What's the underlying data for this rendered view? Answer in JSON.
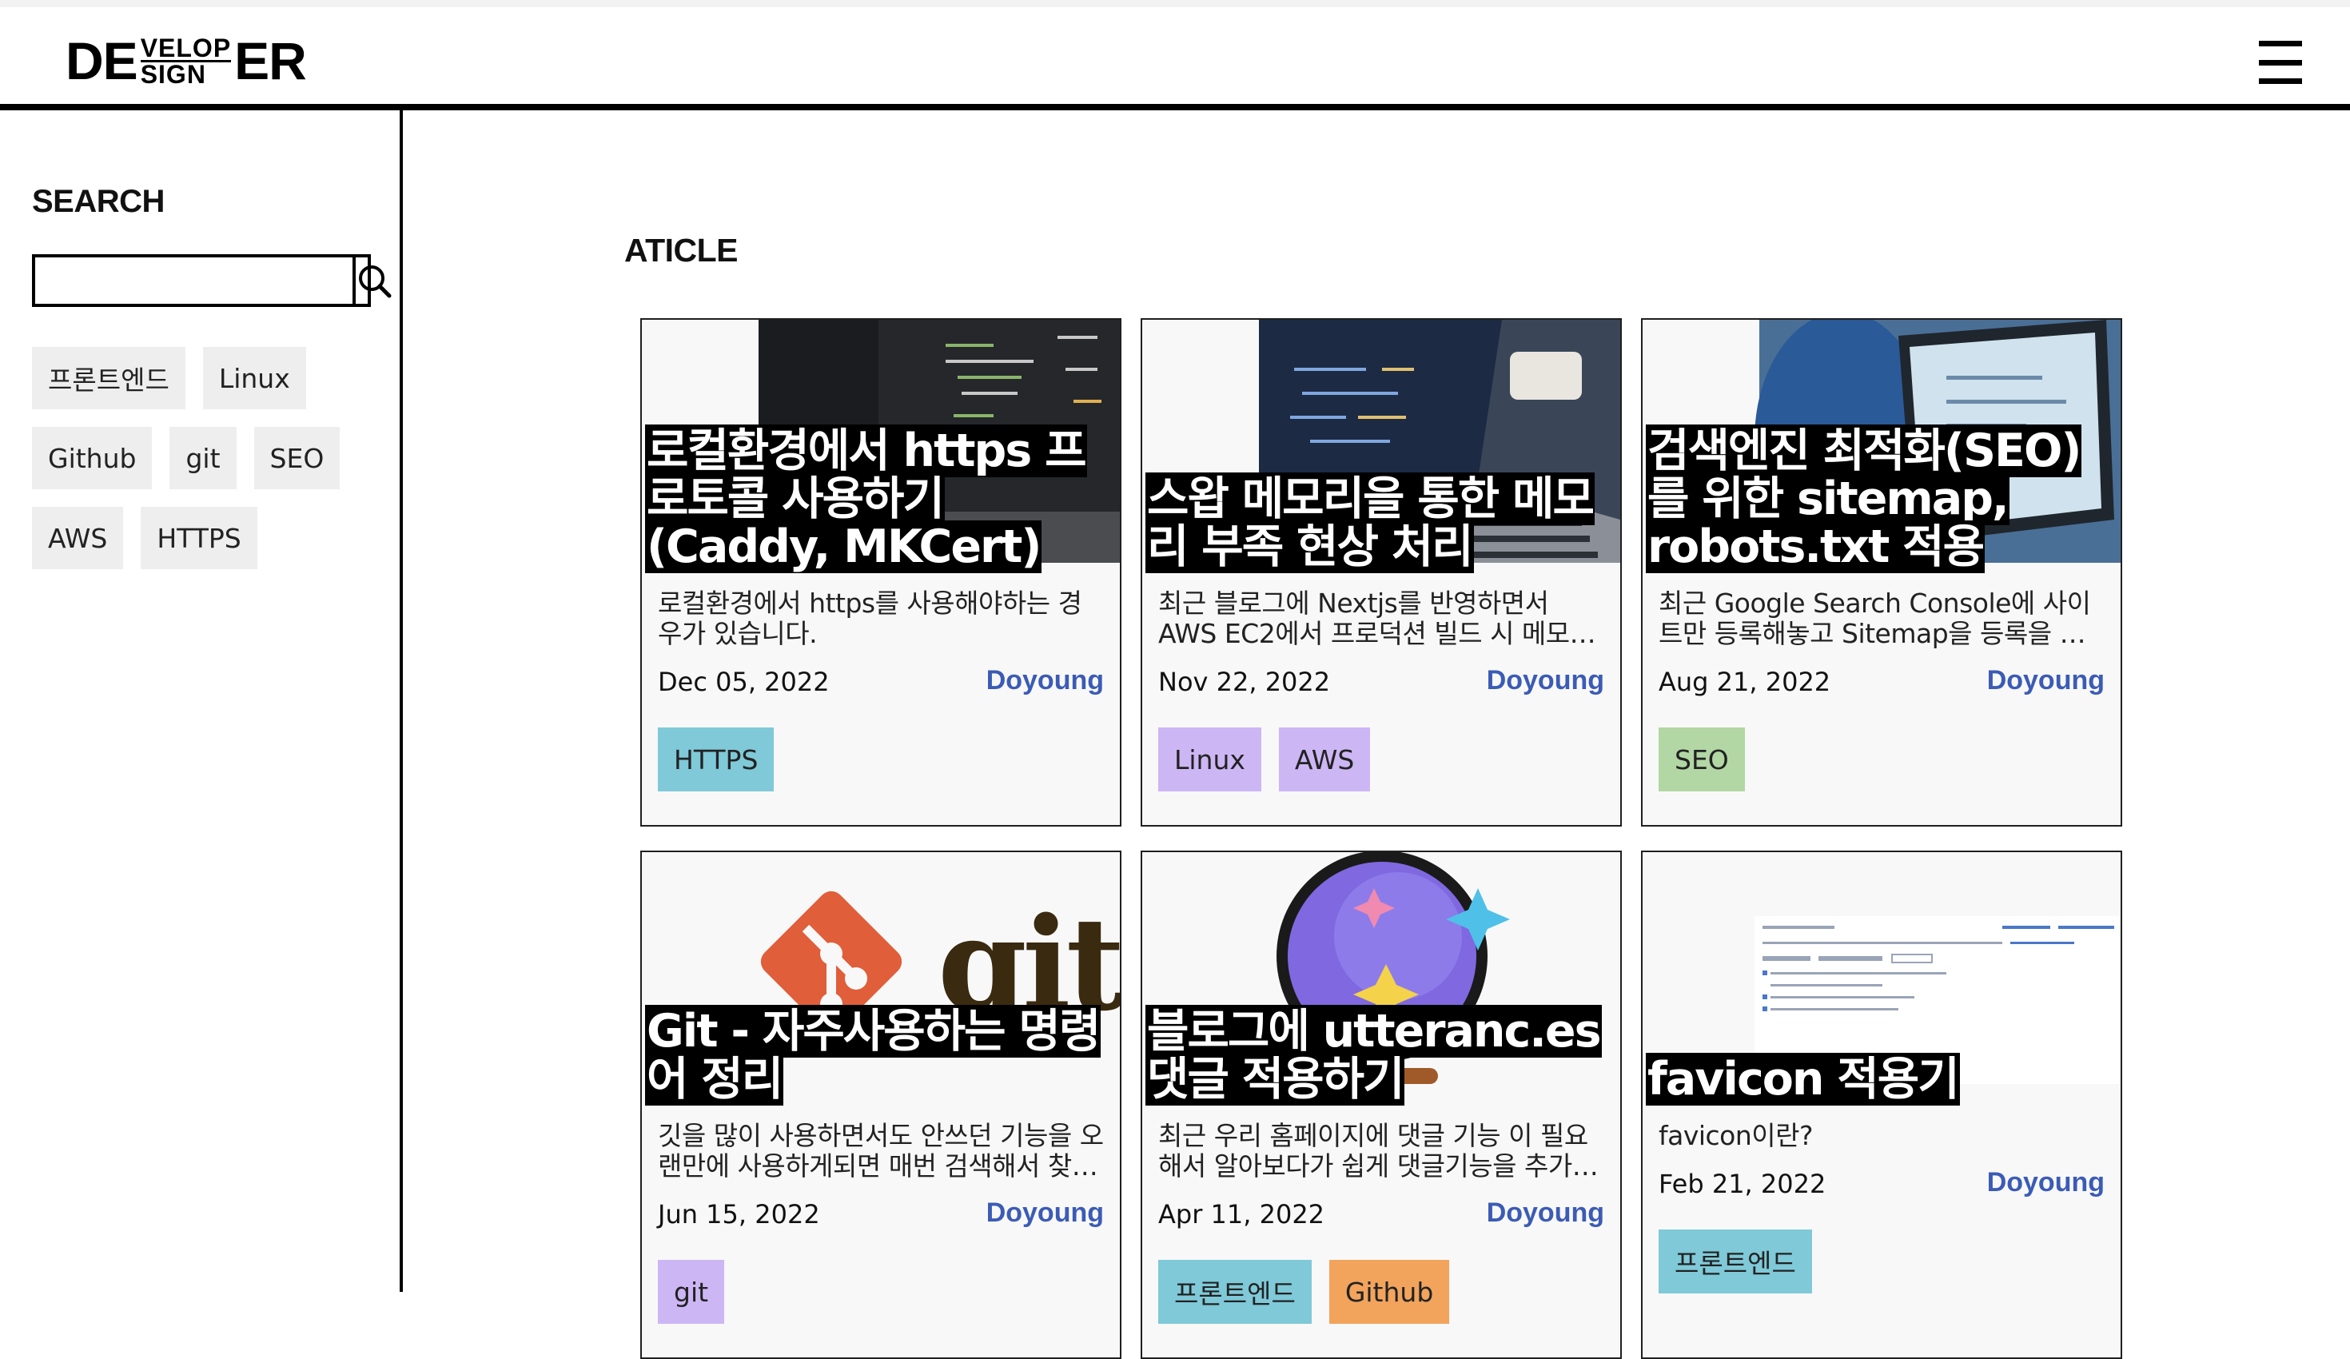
{
  "header": {
    "logo": {
      "left": "DE",
      "top": "VELOP",
      "bottom": "SIGN",
      "right": "ER"
    },
    "menu_icon": "hamburger-menu-icon"
  },
  "sidebar": {
    "search_title": "SEARCH",
    "search_value": "",
    "search_icon": "magnifier-icon",
    "tags": [
      "프론트엔드",
      "Linux",
      "Github",
      "git",
      "SEO",
      "AWS",
      "HTTPS"
    ]
  },
  "main": {
    "title": "ATICLE",
    "articles": [
      {
        "title": "로컬환경에서 https 프로토콜 사용하기 (Caddy, MKCert)",
        "description": "로컬환경에서 https를 사용해야하는 경우가 있습니다.",
        "date": "Dec 05, 2022",
        "author": "Doyoung",
        "tags": [
          "HTTPS"
        ],
        "tag_colors": [
          "#7fc9d8"
        ],
        "image": "code-on-monitor-photo"
      },
      {
        "title": "스왑 메모리을 통한 메모리 부족 현상 처리",
        "description": "최근 블로그에 Nextjs를 반영하면서 AWS EC2에서 프로덕션 빌드 시 메모리 부족 현상이 발생했습니다.",
        "date": "Nov 22, 2022",
        "author": "Doyoung",
        "tags": [
          "Linux",
          "AWS"
        ],
        "tag_colors": [
          "#cdb6f4",
          "#cdb6f4"
        ],
        "image": "laptop-coding-photo"
      },
      {
        "title": "검색엔진 최적화(SEO)를 위한 sitemap, robots.txt 적용",
        "description": "최근 Google Search Console에 사이트만 등록해놓고 Sitemap을 등록을 미루고 있었습니다.",
        "date": "Aug 21, 2022",
        "author": "Doyoung",
        "tags": [
          "SEO"
        ],
        "tag_colors": [
          "#b2d7a4"
        ],
        "image": "person-at-computer-photo"
      },
      {
        "title": "Git - 자주사용하는 명령어 정리",
        "description": " 깃을 많이 사용하면서도 안쓰던 기능을 오랜만에 사용하게되면 매번 검색해서 찾아보게 됩니다.",
        "date": "Jun 15, 2022",
        "author": "Doyoung",
        "tags": [
          "git"
        ],
        "tag_colors": [
          "#cdb6f4"
        ],
        "image": "git-logo",
        "image_text": "git"
      },
      {
        "title": "블로그에 utteranc.es 댓글 적용하기",
        "description": "최근 우리 홈페이지에 댓글 기능 이 필요해서 알아보다가 쉽게 댓글기능을 추가할 수 있는 utterances를 알게 되었습니다.",
        "date": "Apr 11, 2022",
        "author": "Doyoung",
        "tags": [
          "프론트엔드",
          "Github"
        ],
        "tag_colors": [
          "#7fc9d8",
          "#f2a45c"
        ],
        "image": "utterances-logo"
      },
      {
        "title": "favicon 적용기",
        "description": "favicon이란?",
        "date": "Feb 21, 2022",
        "author": "Doyoung",
        "tags": [
          "프론트엔드"
        ],
        "tag_colors": [
          "#7fc9d8"
        ],
        "image": "favicon-generator-screenshot"
      }
    ]
  }
}
